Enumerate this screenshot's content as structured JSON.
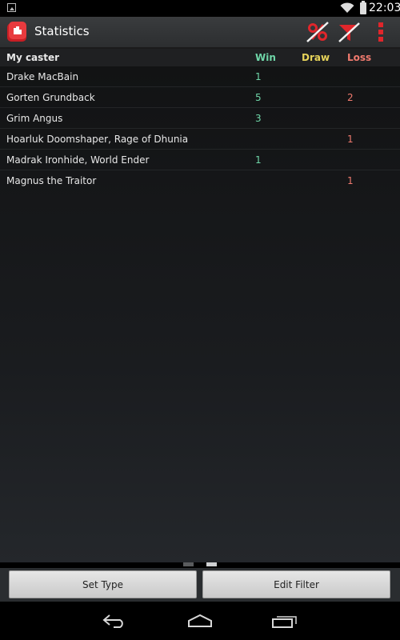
{
  "status_bar": {
    "time": "22:03"
  },
  "action_bar": {
    "title": "Statistics",
    "percent_icon": "percent-off-icon",
    "filter_icon": "filter-off-icon",
    "overflow_icon": "overflow-menu-icon"
  },
  "table": {
    "headers": {
      "caster": "My caster",
      "win": "Win",
      "draw": "Draw",
      "loss": "Loss"
    },
    "rows": [
      {
        "name": "Drake MacBain",
        "win": "1",
        "draw": "",
        "loss": ""
      },
      {
        "name": "Gorten Grundback",
        "win": "5",
        "draw": "",
        "loss": "2"
      },
      {
        "name": "Grim Angus",
        "win": "3",
        "draw": "",
        "loss": ""
      },
      {
        "name": "Hoarluk Doomshaper, Rage of Dhunia",
        "win": "",
        "draw": "",
        "loss": "1"
      },
      {
        "name": "Madrak Ironhide, World Ender",
        "win": "1",
        "draw": "",
        "loss": ""
      },
      {
        "name": "Magnus the Traitor",
        "win": "",
        "draw": "",
        "loss": "1"
      }
    ]
  },
  "buttons": {
    "set_type": "Set Type",
    "edit_filter": "Edit Filter"
  },
  "colors": {
    "win": "#6fd6a8",
    "draw": "#e6d35a",
    "loss": "#f07a6e",
    "accent": "#e0262b"
  }
}
